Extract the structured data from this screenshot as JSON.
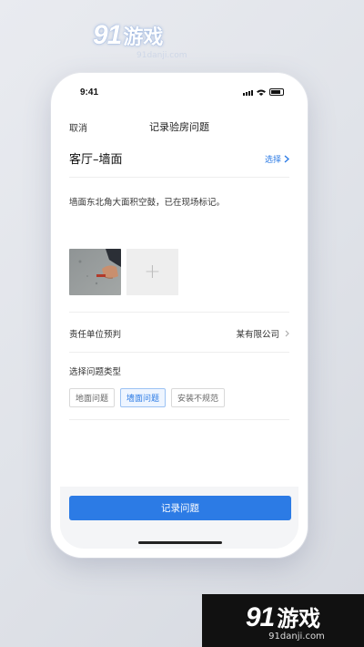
{
  "watermark": {
    "logo_num": "91",
    "logo_cn": "游戏",
    "site": "91danji.com"
  },
  "status_bar": {
    "time": "9:41"
  },
  "nav": {
    "cancel_label": "取消",
    "title": "记录验房问题"
  },
  "room": {
    "name": "客厅–墙面",
    "choose_label": "选择"
  },
  "issue": {
    "description": "墙面东北角大面积空鼓，已在现场标记。"
  },
  "responsible": {
    "label": "责任单位预判",
    "value": "某有限公司"
  },
  "issue_type": {
    "label": "选择问题类型",
    "options": [
      "地面问题",
      "墙面问题",
      "安装不规范"
    ],
    "selected": "墙面问题"
  },
  "footer": {
    "record_button": "记录问题"
  },
  "colors": {
    "accent": "#2c7be5",
    "chip_active_bg": "#eef5ff"
  }
}
